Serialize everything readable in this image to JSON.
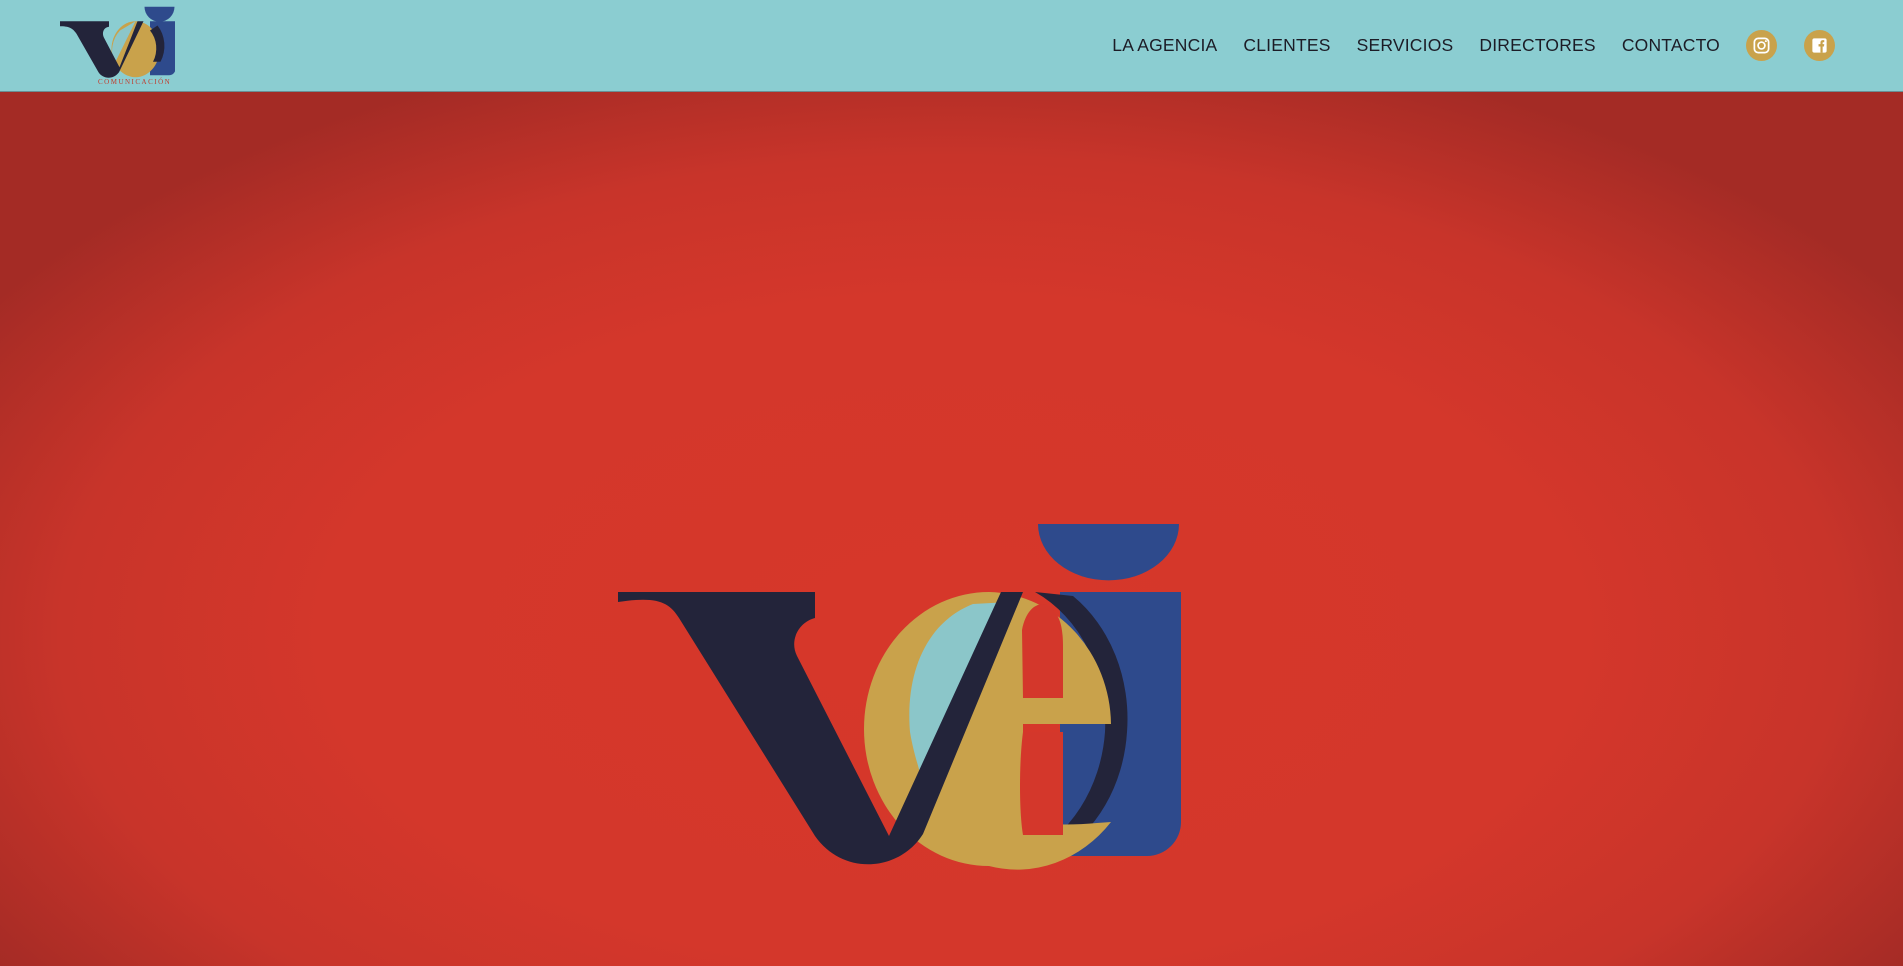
{
  "brand": {
    "tagline": "COMUNICACIÓN",
    "colors": {
      "header_bg": "#8bcdd1",
      "hero_bg": "#d4372b",
      "navy": "#23243a",
      "gold": "#c9a24b",
      "blue": "#2e4a8c",
      "light_blue": "#8bc6c9"
    }
  },
  "nav": {
    "items": [
      {
        "label": "LA AGENCIA"
      },
      {
        "label": "CLIENTES"
      },
      {
        "label": "SERVICIOS"
      },
      {
        "label": "DIRECTORES"
      },
      {
        "label": "CONTACTO"
      }
    ],
    "social": [
      {
        "icon": "instagram-icon"
      },
      {
        "icon": "facebook-icon"
      }
    ]
  }
}
